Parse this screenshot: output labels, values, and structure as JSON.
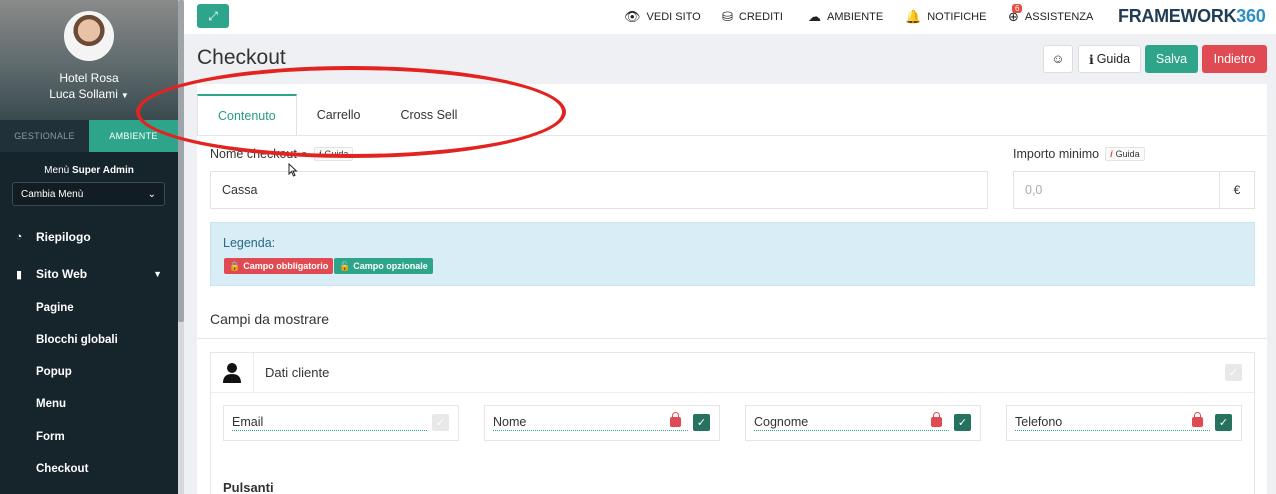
{
  "sidebar": {
    "hotel": "Hotel Rosa",
    "user": "Luca Sollami",
    "tabs": [
      "GESTIONALE",
      "AMBIENTE"
    ],
    "menu_label_prefix": "Menù",
    "menu_label_bold": "Super Admin",
    "menu_select": "Cambia Menù",
    "items": [
      {
        "label": "Riepilogo",
        "icon": "dashboard-icon"
      },
      {
        "label": "Sito Web",
        "icon": "file-icon"
      }
    ],
    "subitems": [
      "Pagine",
      "Blocchi globali",
      "Popup",
      "Menu",
      "Form",
      "Checkout"
    ]
  },
  "topbar": {
    "links": [
      {
        "label": "VEDI SITO",
        "icon": "eye-icon"
      },
      {
        "label": "CREDITI",
        "icon": "coins-icon"
      },
      {
        "label": "AMBIENTE",
        "icon": "cloud-icon"
      },
      {
        "label": "NOTIFICHE",
        "icon": "bell-icon"
      },
      {
        "label": "ASSISTENZA",
        "icon": "support-icon",
        "badge": "6"
      }
    ],
    "brand_text": "FRAMEWORK",
    "brand_num": "360"
  },
  "header": {
    "title": "Checkout",
    "guida": "Guida",
    "salva": "Salva",
    "indietro": "Indietro"
  },
  "tabs": [
    "Contenuto",
    "Carrello",
    "Cross Sell"
  ],
  "form": {
    "nome_label": "Nome checkout",
    "nome_value": "Cassa",
    "importo_label": "Importo minimo",
    "importo_placeholder": "0,0",
    "currency": "€",
    "guida_mini": "Guida"
  },
  "legend": {
    "title": "Legenda:",
    "required": "Campo obbligatorio",
    "optional": "Campo opzionale"
  },
  "section": {
    "title": "Campi da mostrare",
    "group_title": "Dati cliente",
    "fields": [
      {
        "label": "Email",
        "required": false,
        "checked": false
      },
      {
        "label": "Nome",
        "required": true,
        "checked": true
      },
      {
        "label": "Cognome",
        "required": true,
        "checked": true
      },
      {
        "label": "Telefono",
        "required": true,
        "checked": true
      }
    ],
    "next_title": "Pulsanti"
  },
  "colors": {
    "accent": "#2ea58b",
    "danger": "#e04b53",
    "sidebar": "#16242c",
    "annotation": "#e3231f"
  }
}
